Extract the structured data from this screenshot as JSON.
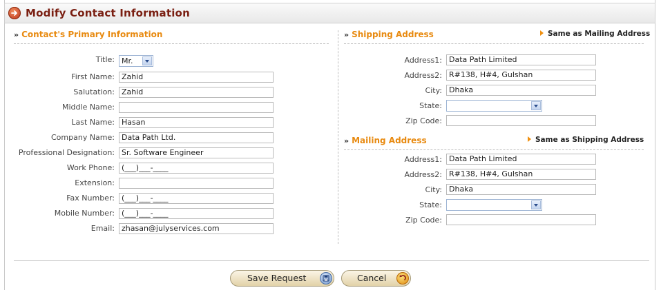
{
  "title": "Modify Contact Information",
  "primary": {
    "heading": "Contact's Primary Information",
    "labels": {
      "title": "Title:",
      "first_name": "First Name:",
      "salutation": "Salutation:",
      "middle_name": "Middle Name:",
      "last_name": "Last Name:",
      "company": "Company Name:",
      "designation": "Professional Designation:",
      "work_phone": "Work Phone:",
      "extension": "Extension:",
      "fax": "Fax Number:",
      "mobile": "Mobile Number:",
      "email": "Email:"
    },
    "values": {
      "title": "Mr.",
      "first_name": "Zahid",
      "salutation": "Zahid",
      "middle_name": "",
      "last_name": "Hasan",
      "company": "Data Path Ltd.",
      "designation": "Sr. Software Engineer",
      "work_phone": "(___)___-____",
      "extension": "",
      "fax": "(___)___-____",
      "mobile": "(___)___-____",
      "email": "zhasan@julyservices.com"
    }
  },
  "shipping": {
    "heading": "Shipping Address",
    "same_link": "Same as Mailing Address",
    "labels": {
      "address1": "Address1:",
      "address2": "Address2:",
      "city": "City:",
      "state": "State:",
      "zip": "Zip Code:"
    },
    "values": {
      "address1": "Data Path Limited",
      "address2": "R#138, H#4, Gulshan",
      "city": "Dhaka",
      "state": "",
      "zip": ""
    }
  },
  "mailing": {
    "heading": "Mailing Address",
    "same_link": "Same as Shipping Address",
    "labels": {
      "address1": "Address1:",
      "address2": "Address2:",
      "city": "City:",
      "state": "State:",
      "zip": "Zip Code:"
    },
    "values": {
      "address1": "Data Path Limited",
      "address2": "R#138, H#4, Gulshan",
      "city": "Dhaka",
      "state": "",
      "zip": ""
    }
  },
  "buttons": {
    "save": "Save Request",
    "cancel": "Cancel"
  },
  "colors": {
    "title": "#7a1f12",
    "section_heading": "#e88a10",
    "link_marker": "#f09010"
  }
}
